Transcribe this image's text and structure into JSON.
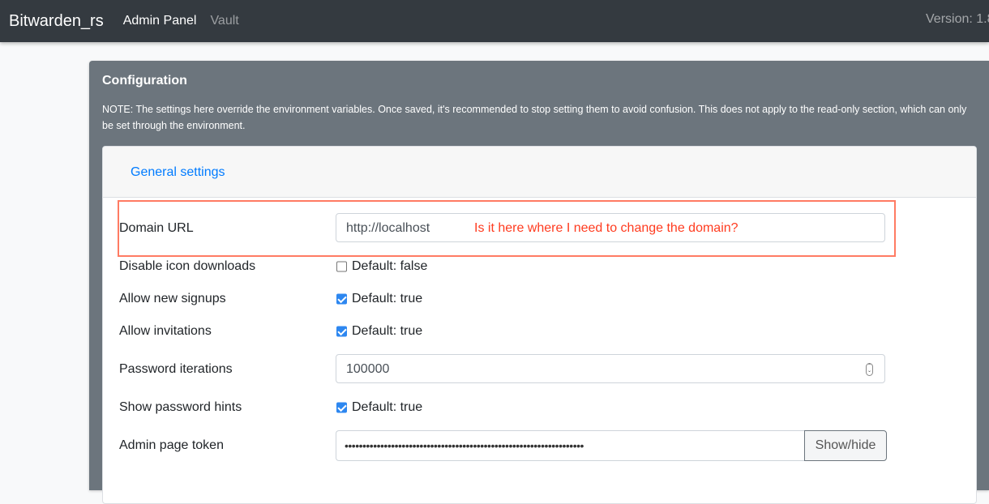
{
  "navbar": {
    "brand": "Bitwarden_rs",
    "links": [
      "Admin Panel",
      "Vault"
    ],
    "version": "Version: 1.8"
  },
  "config": {
    "title": "Configuration",
    "note": "NOTE: The settings here override the environment variables. Once saved, it's recommended to stop setting them to avoid confusion. This does not apply to the read-only section, which can only be set through the environment.",
    "section_link": "General settings",
    "rows": {
      "domain": {
        "label": "Domain URL",
        "value": "http://localhost",
        "annotation": "Is it here where I need to change the domain?"
      },
      "disable_icons": {
        "label": "Disable icon downloads",
        "checked": false,
        "default_text": "Default: false"
      },
      "allow_signups": {
        "label": "Allow new signups",
        "checked": true,
        "default_text": "Default: true"
      },
      "allow_invitations": {
        "label": "Allow invitations",
        "checked": true,
        "default_text": "Default: true"
      },
      "password_iterations": {
        "label": "Password iterations",
        "value": "100000"
      },
      "show_hints": {
        "label": "Show password hints",
        "checked": true,
        "default_text": "Default: true"
      },
      "admin_token": {
        "label": "Admin page token",
        "value": "•••••••••••••••••••••••••••••••••••••••••••••••••••••••••••••••••••",
        "button": "Show/hide"
      }
    }
  },
  "colors": {
    "navbar": "#343a40",
    "card": "#6c757d",
    "link": "#007bff",
    "annotation": "#ff3b1f",
    "checkbox": "#2d87f0"
  }
}
